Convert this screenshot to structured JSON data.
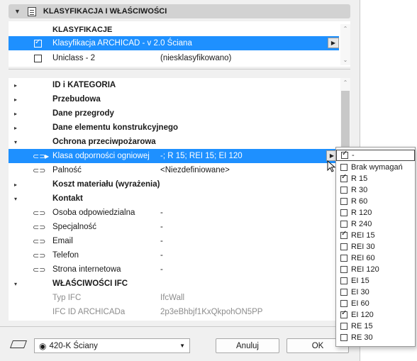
{
  "section": {
    "title": "KLASYFIKACJA I WŁAŚCIWOŚCI"
  },
  "classification": {
    "header": "KLASYFIKACJE",
    "rows": [
      {
        "label": "Klasyfikacja ARCHICAD - v 2.0 Ściana",
        "value": "",
        "checked": true
      },
      {
        "label": "Uniclass - 2",
        "value": "(niesklasyfikowano)",
        "checked": false
      }
    ]
  },
  "tree": [
    {
      "name": "ID i KATEGORIA",
      "expander": "▸"
    },
    {
      "name": "Przebudowa",
      "expander": "▸"
    },
    {
      "name": "Dane przegrody",
      "expander": "▸"
    },
    {
      "name": "Dane elementu konstrukcyjnego",
      "expander": "▸"
    },
    {
      "name": "Ochrona przeciwpożarowa",
      "expander": "▾"
    },
    {
      "name": "Klasa odporności ogniowej",
      "value": "-; R 15; REI 15; EI 120"
    },
    {
      "name": "Palność",
      "value": "<Niezdefiniowane>"
    },
    {
      "name": "Koszt materiału (wyrażenia)",
      "expander": "▸"
    },
    {
      "name": "Kontakt",
      "expander": "▾"
    },
    {
      "name": "Osoba odpowiedzialna",
      "value": "-"
    },
    {
      "name": "Specjalność",
      "value": "-"
    },
    {
      "name": "Email",
      "value": "-"
    },
    {
      "name": "Telefon",
      "value": "-"
    },
    {
      "name": "Strona internetowa",
      "value": "-"
    },
    {
      "name": "WŁAŚCIWOŚCI IFC",
      "expander": "▾"
    },
    {
      "name": "Typ IFC",
      "value": "IfcWall"
    },
    {
      "name": "IFC ID ARCHICADa",
      "value": "2p3eBhbjf1KxQkpohON5PP"
    }
  ],
  "footer": {
    "layer_combo": "420-K Ściany",
    "cancel": "Anuluj",
    "ok": "OK"
  },
  "dropdown": {
    "options": [
      {
        "label": "-",
        "checked": true
      },
      {
        "label": "Brak wymagań",
        "checked": false
      },
      {
        "label": "R 15",
        "checked": true
      },
      {
        "label": "R 30",
        "checked": false
      },
      {
        "label": "R 60",
        "checked": false
      },
      {
        "label": "R 120",
        "checked": false
      },
      {
        "label": "R 240",
        "checked": false
      },
      {
        "label": "REI 15",
        "checked": true
      },
      {
        "label": "REI 30",
        "checked": false
      },
      {
        "label": "REI 60",
        "checked": false
      },
      {
        "label": "REI 120",
        "checked": false
      },
      {
        "label": "EI 15",
        "checked": false
      },
      {
        "label": "EI 30",
        "checked": false
      },
      {
        "label": "EI 60",
        "checked": false
      },
      {
        "label": "EI 120",
        "checked": true
      },
      {
        "label": "RE 15",
        "checked": false
      },
      {
        "label": "RE 30",
        "checked": false
      }
    ]
  },
  "colors": {
    "selection": "#1e90ff",
    "panel": "#f0f0f0",
    "header": "#d2d2d2"
  }
}
